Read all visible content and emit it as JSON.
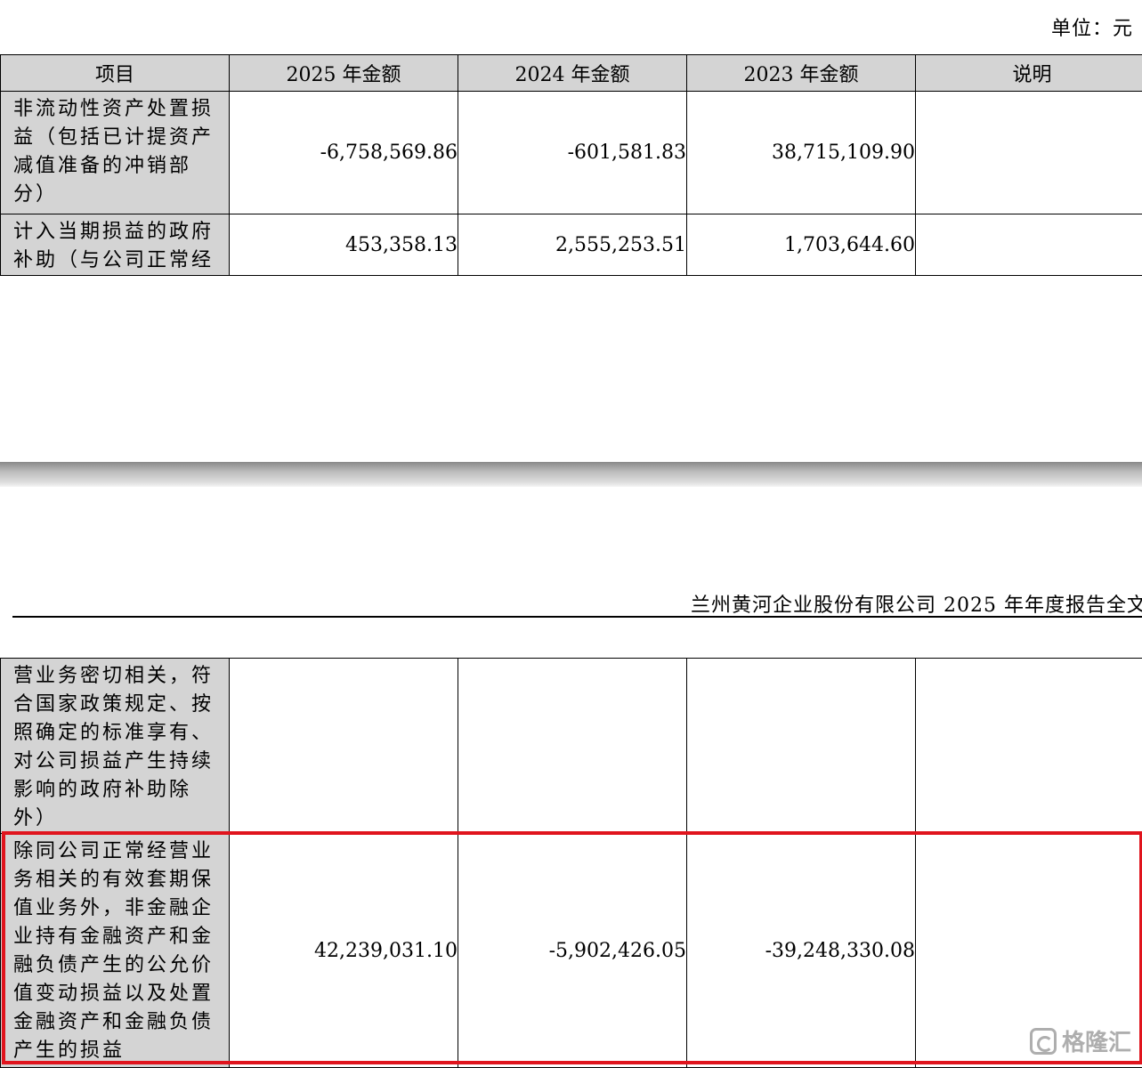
{
  "unit_label": "单位：元",
  "page_header": "兰州黄河企业股份有限公司 2025 年年度报告全文",
  "table": {
    "headers": [
      "项目",
      "2025 年金额",
      "2024 年金额",
      "2023 年金额",
      "说明"
    ],
    "rows": [
      {
        "label": "非流动性资产处置损益（包括已计提资产减值准备的冲销部分）",
        "v2025": "-6,758,569.86",
        "v2024": "-601,581.83",
        "v2023": "38,715,109.90",
        "note": ""
      },
      {
        "label_part1": "计入当期损益的政府补助（与公司正常经",
        "label_part2": "营业务密切相关，符合国家政策规定、按照确定的标准享有、对公司损益产生持续影响的政府补助除外）",
        "v2025": "453,358.13",
        "v2024": "2,555,253.51",
        "v2023": "1,703,644.60",
        "note": ""
      },
      {
        "label": "除同公司正常经营业务相关的有效套期保值业务外，非金融企业持有金融资产和金融负债产生的公允价值变动损益以及处置金融资产和金融负债产生的损益",
        "v2025": "42,239,031.10",
        "v2024": "-5,902,426.05",
        "v2023": "-39,248,330.08",
        "note": ""
      }
    ]
  },
  "watermark": "格隆汇",
  "colors": {
    "highlight": "#e0141d",
    "label_bg": "#d4d4d4"
  }
}
